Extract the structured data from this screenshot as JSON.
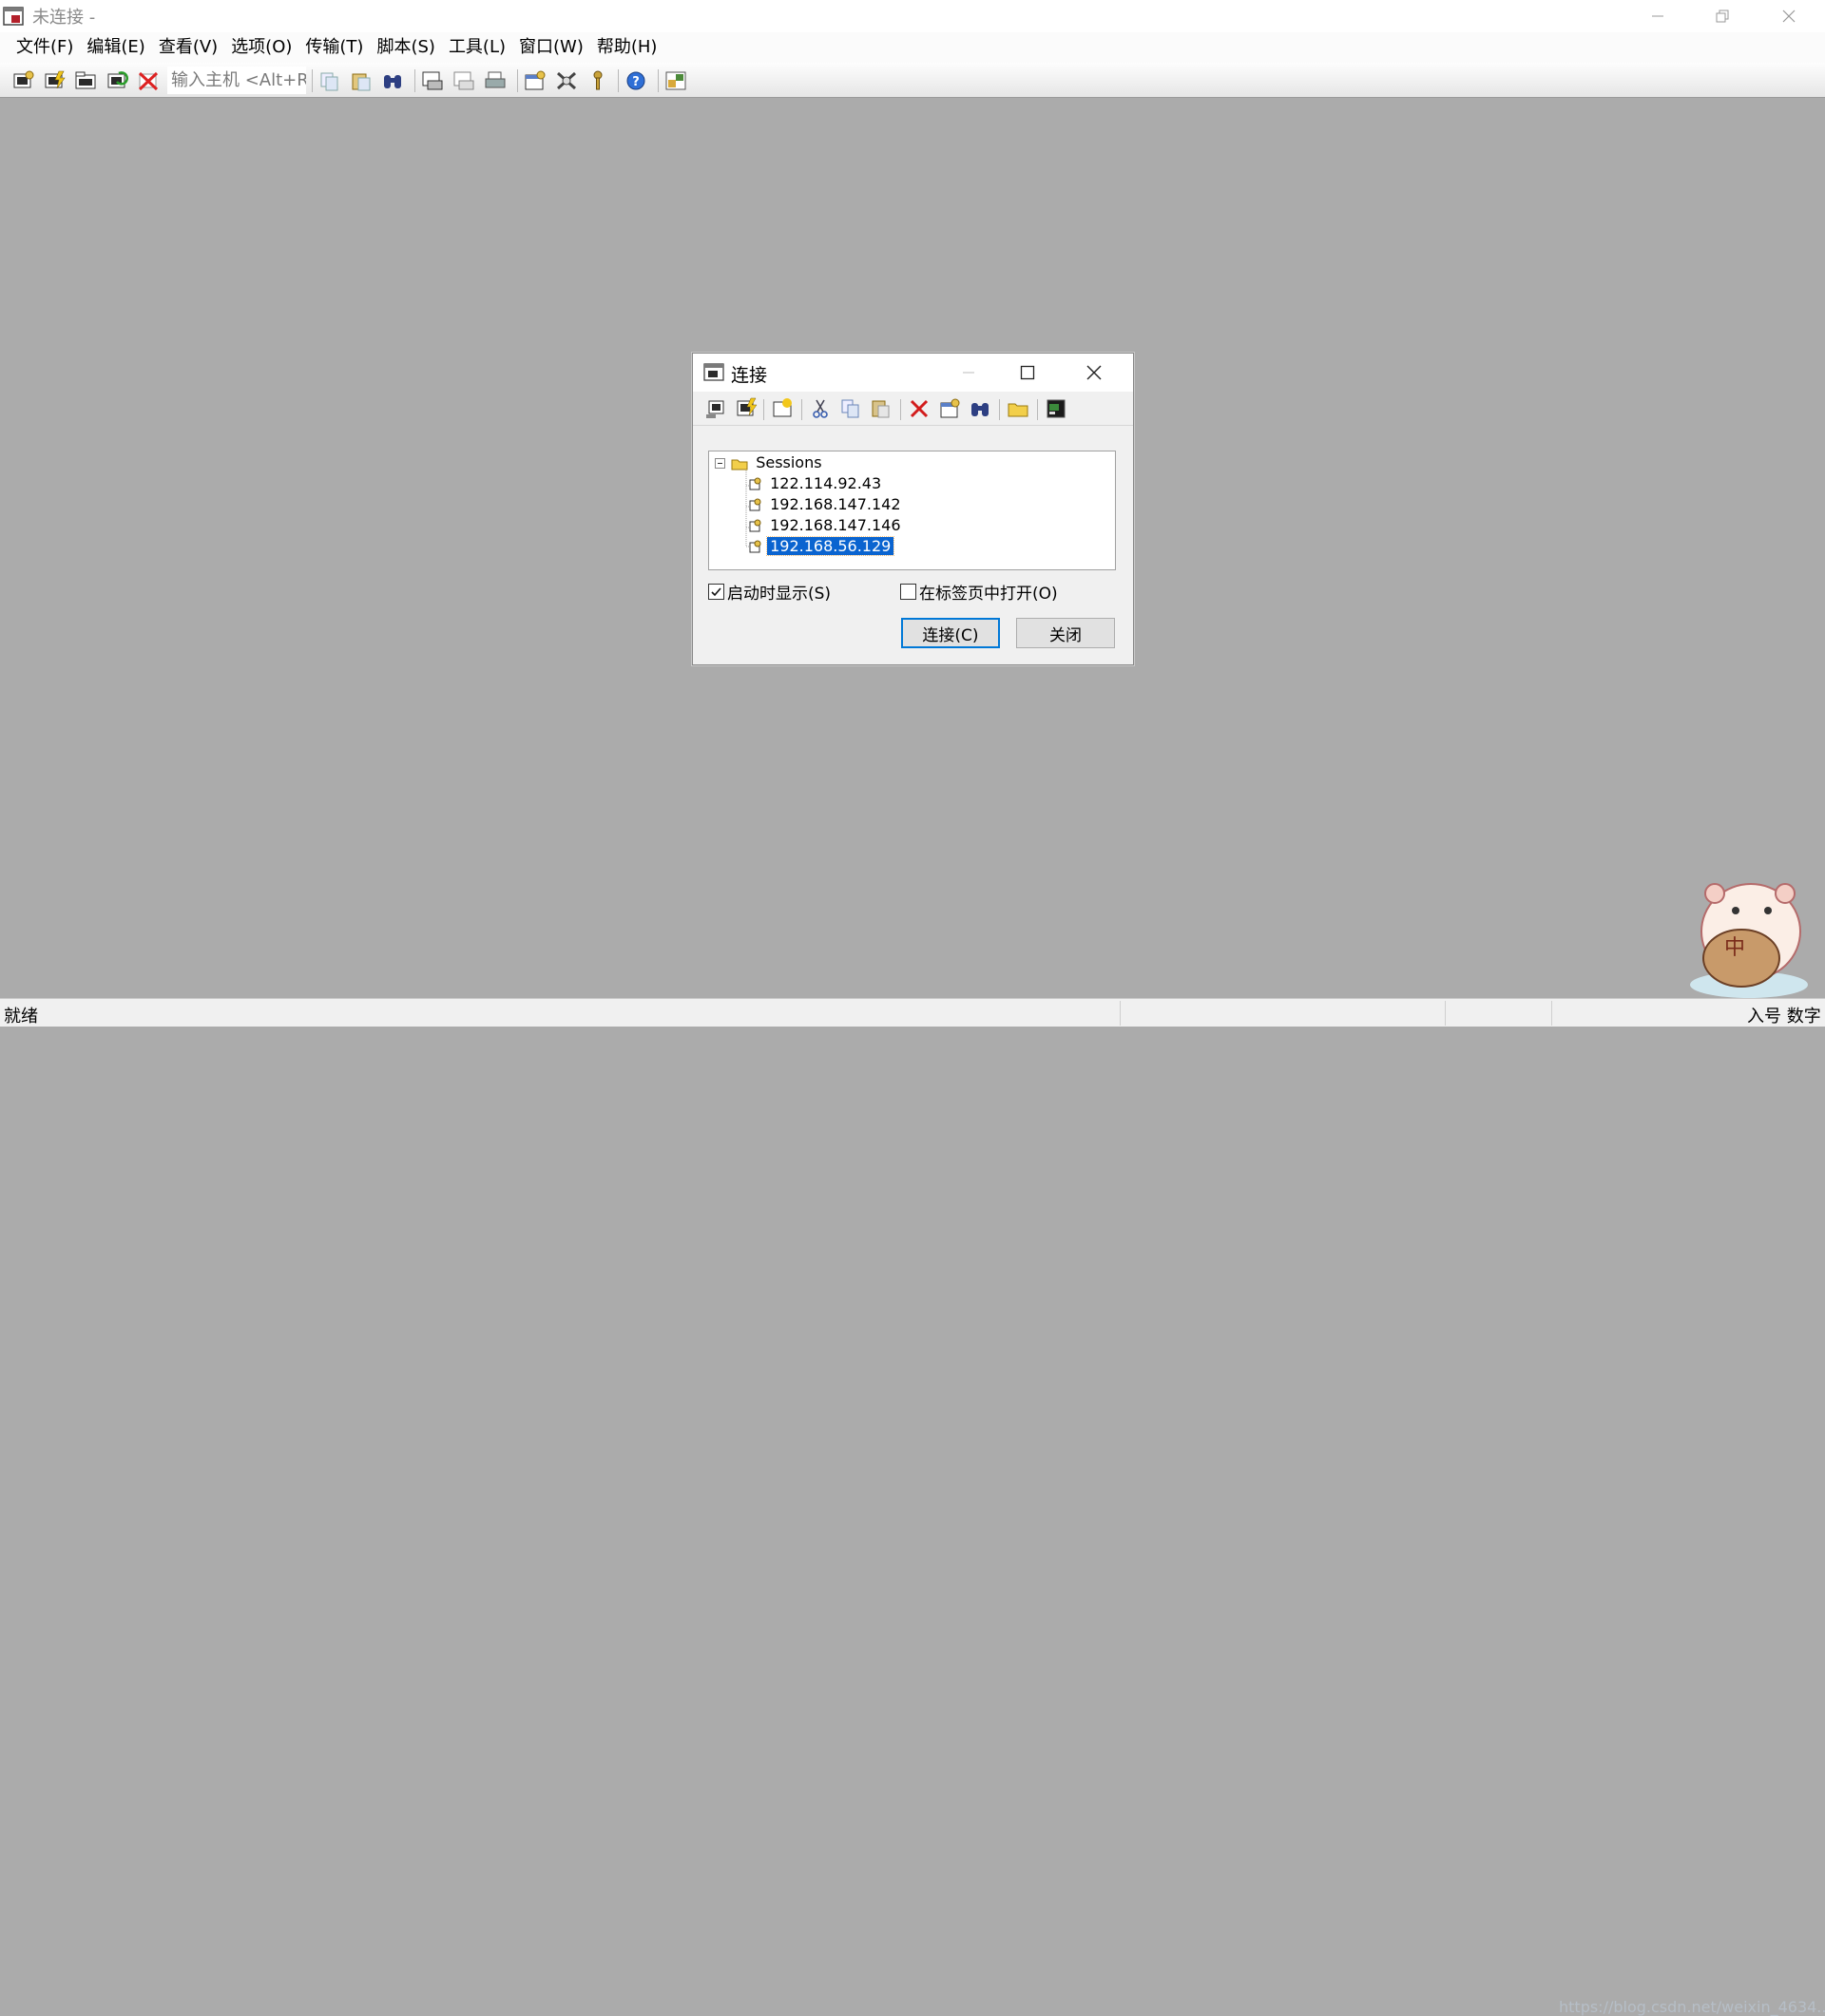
{
  "window": {
    "title": "未连接 -"
  },
  "menu": [
    "文件(F)",
    "编辑(E)",
    "查看(V)",
    "选项(O)",
    "传输(T)",
    "脚本(S)",
    "工具(L)",
    "窗口(W)",
    "帮助(H)"
  ],
  "toolbar": {
    "host_placeholder": "输入主机 <Alt+R>",
    "icons": [
      "connect-icon",
      "quick-connect-icon",
      "connect-in-tab-icon",
      "reconnect-icon",
      "disconnect-icon",
      "copy-icon",
      "paste-icon",
      "find-icon",
      "print-setup-icon",
      "print-selection-icon",
      "print-icon",
      "session-options-icon",
      "global-options-icon",
      "key-icon",
      "help-icon",
      "sftp-icon"
    ]
  },
  "dialog": {
    "title": "连接",
    "tree": {
      "root": "Sessions",
      "items": [
        "122.114.92.43",
        "192.168.147.142",
        "192.168.147.146",
        "192.168.56.129"
      ],
      "selected_index": 3
    },
    "show_on_startup": {
      "label": "启动时显示(S)",
      "checked": true
    },
    "open_in_tab": {
      "label": "在标签页中打开(O)",
      "checked": false
    },
    "connect_button": "连接(C)",
    "close_button": "关闭"
  },
  "status": {
    "text": "就绪",
    "ime": "入号 数字",
    "watermark": "https://blog.csdn.net/weixin_4634..."
  }
}
